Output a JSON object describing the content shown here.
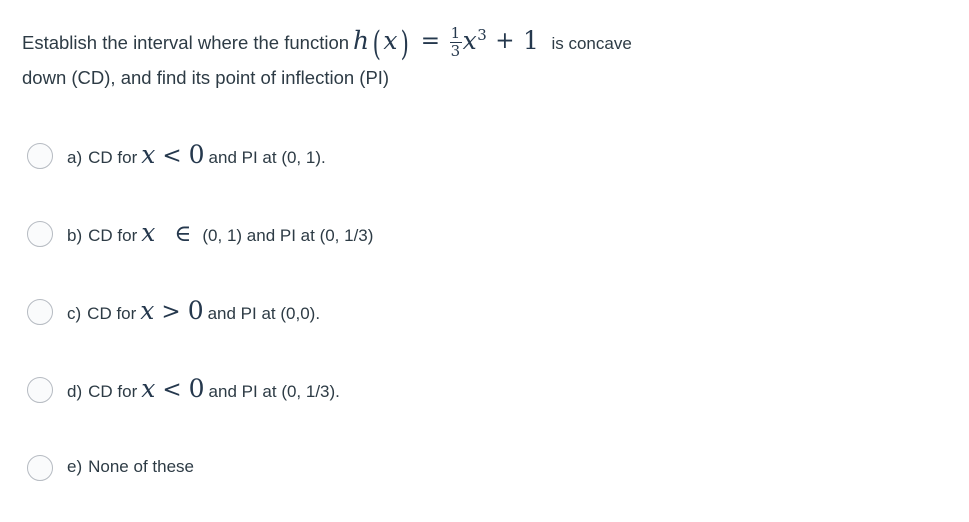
{
  "question": {
    "stem_part1": "Establish the interval where the function",
    "formula": {
      "function_name": "h",
      "variable": "x",
      "equals": "=",
      "fraction_numerator": "1",
      "fraction_denominator": "3",
      "term_variable": "x",
      "exponent": "3",
      "plus": "+",
      "constant": "1",
      "full_latex": "h(x) = \\frac{1}{3}x^3 + 1"
    },
    "stem_part2": "is concave",
    "stem_line2": "down (CD), and find its point of inflection (PI)"
  },
  "options": [
    {
      "letter": "a)",
      "prefix": "CD for",
      "variable": "x",
      "operator": "<",
      "operand": "0",
      "suffix": "and PI at (0, 1).",
      "full_text": "a) CD for x < 0 and PI at (0, 1).",
      "selected": false
    },
    {
      "letter": "b)",
      "prefix": "CD for",
      "variable": "x",
      "operator": "∈",
      "operand": "",
      "suffix": "(0, 1) and PI at (0, 1/3)",
      "full_text": "b) CD for x ∈ (0, 1) and PI at (0, 1/3)",
      "selected": false
    },
    {
      "letter": "c)",
      "prefix": "CD for",
      "variable": "x",
      "operator": ">",
      "operand": "0",
      "suffix": "and PI at (0,0).",
      "full_text": "c) CD for x > 0 and PI at (0,0).",
      "selected": false
    },
    {
      "letter": "d)",
      "prefix": "CD for",
      "variable": "x",
      "operator": "<",
      "operand": "0",
      "suffix": "and PI at (0, 1/3).",
      "full_text": "d) CD for x < 0 and PI at (0, 1/3).",
      "selected": false
    },
    {
      "letter": "e)",
      "prefix": "",
      "variable": "",
      "operator": "",
      "operand": "",
      "suffix": "None of these",
      "full_text": "e) None of these",
      "selected": false
    }
  ],
  "colors": {
    "background": "#ffffff",
    "text": "#2d3b45",
    "math_text": "#25384d",
    "radio_border": "#b6bbc2",
    "radio_fill": "#fafbfc"
  }
}
